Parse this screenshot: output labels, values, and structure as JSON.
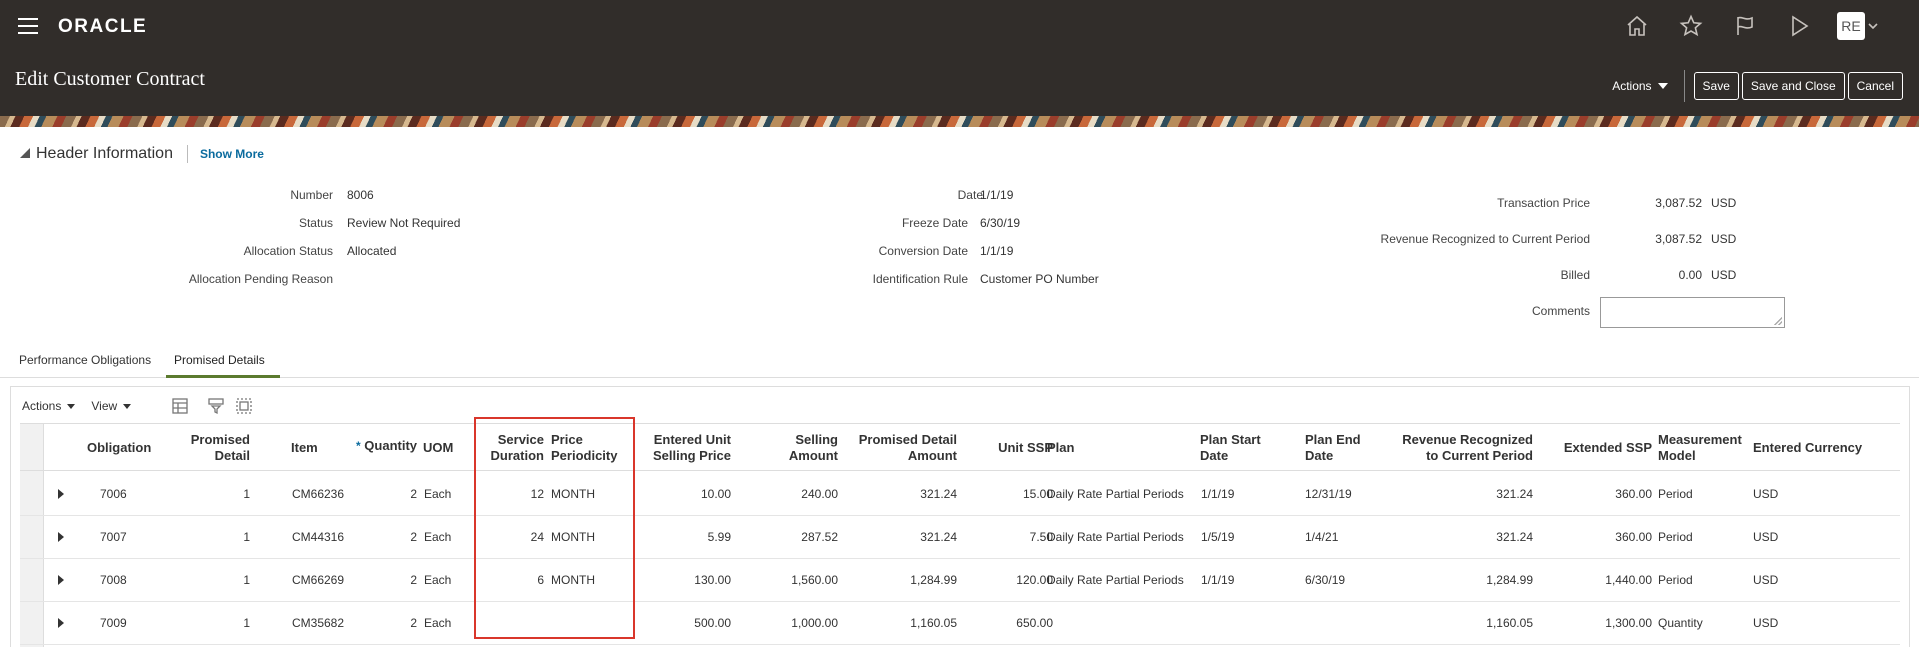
{
  "app": {
    "logo": "ORACLE",
    "avatar": "RE"
  },
  "page": {
    "title": "Edit Customer Contract"
  },
  "header_actions": {
    "actions_label": "Actions",
    "save": "Save",
    "save_close": "Save and Close",
    "cancel": "Cancel"
  },
  "section": {
    "title": "Header Information",
    "show_more": "Show More"
  },
  "info": {
    "number_label": "Number",
    "number": "8006",
    "status_label": "Status",
    "status": "Review Not Required",
    "alloc_status_label": "Allocation Status",
    "alloc_status": "Allocated",
    "alloc_pending_label": "Allocation Pending Reason",
    "date_label": "Date",
    "date": "1/1/19",
    "freeze_label": "Freeze Date",
    "freeze": "6/30/19",
    "conversion_label": "Conversion Date",
    "conversion": "1/1/19",
    "ident_label": "Identification Rule",
    "ident": "Customer PO Number",
    "tprice_label": "Transaction Price",
    "tprice": "3,087.52",
    "tprice_cur": "USD",
    "rev_label": "Revenue Recognized to Current Period",
    "rev": "3,087.52",
    "rev_cur": "USD",
    "billed_label": "Billed",
    "billed": "0.00",
    "billed_cur": "USD",
    "comments_label": "Comments"
  },
  "tabs": [
    "Performance Obligations",
    "Promised Details"
  ],
  "toolbar": {
    "actions": "Actions",
    "view": "View"
  },
  "columns": {
    "obligation": "Obligation",
    "promised_1": "Promised",
    "promised_2": "Detail",
    "item": "Item",
    "qty_star": "*",
    "quantity": "Quantity",
    "uom": "UOM",
    "svc_1": "Service",
    "svc_2": "Duration",
    "pp_1": "Price",
    "pp_2": "Periodicity",
    "eusp_1": "Entered Unit",
    "eusp_2": "Selling Price",
    "sa_1": "Selling",
    "sa_2": "Amount",
    "pda_1": "Promised Detail",
    "pda_2": "Amount",
    "unit_ssp": "Unit SSP",
    "plan": "Plan",
    "psd_1": "Plan Start",
    "psd_2": "Date",
    "ped_1": "Plan End",
    "ped_2": "Date",
    "rr_1": "Revenue Recognized",
    "rr_2": "to Current Period",
    "ext_ssp": "Extended SSP",
    "mm_1": "Measurement",
    "mm_2": "Model",
    "entered_currency": "Entered Currency"
  },
  "rows": [
    {
      "obligation": "7006",
      "promised": "1",
      "item": "CM66236",
      "quantity": "2",
      "uom": "Each",
      "service_duration": "12",
      "price_periodicity": "MONTH",
      "entered_unit_selling_price": "10.00",
      "selling_amount": "240.00",
      "promised_detail_amount": "321.24",
      "unit_ssp": "15.00",
      "plan": "Daily Rate Partial Periods",
      "plan_start": "1/1/19",
      "plan_end": "12/31/19",
      "revenue_recognized": "321.24",
      "extended_ssp": "360.00",
      "measurement_model": "Period",
      "currency": "USD"
    },
    {
      "obligation": "7007",
      "promised": "1",
      "item": "CM44316",
      "quantity": "2",
      "uom": "Each",
      "service_duration": "24",
      "price_periodicity": "MONTH",
      "entered_unit_selling_price": "5.99",
      "selling_amount": "287.52",
      "promised_detail_amount": "321.24",
      "unit_ssp": "7.50",
      "plan": "Daily Rate Partial Periods",
      "plan_start": "1/5/19",
      "plan_end": "1/4/21",
      "revenue_recognized": "321.24",
      "extended_ssp": "360.00",
      "measurement_model": "Period",
      "currency": "USD"
    },
    {
      "obligation": "7008",
      "promised": "1",
      "item": "CM66269",
      "quantity": "2",
      "uom": "Each",
      "service_duration": "6",
      "price_periodicity": "MONTH",
      "entered_unit_selling_price": "130.00",
      "selling_amount": "1,560.00",
      "promised_detail_amount": "1,284.99",
      "unit_ssp": "120.00",
      "plan": "Daily Rate Partial Periods",
      "plan_start": "1/1/19",
      "plan_end": "6/30/19",
      "revenue_recognized": "1,284.99",
      "extended_ssp": "1,440.00",
      "measurement_model": "Period",
      "currency": "USD"
    },
    {
      "obligation": "7009",
      "promised": "1",
      "item": "CM35682",
      "quantity": "2",
      "uom": "Each",
      "service_duration": "",
      "price_periodicity": "",
      "entered_unit_selling_price": "500.00",
      "selling_amount": "1,000.00",
      "promised_detail_amount": "1,160.05",
      "unit_ssp": "650.00",
      "plan": "",
      "plan_start": "",
      "plan_end": "",
      "revenue_recognized": "1,160.05",
      "extended_ssp": "1,300.00",
      "measurement_model": "Quantity",
      "currency": "USD"
    }
  ],
  "colors": {
    "header_bg": "#312d2a",
    "link": "#0a6b9e",
    "highlight": "#d9362b",
    "tab_active": "#5b7a2e"
  }
}
